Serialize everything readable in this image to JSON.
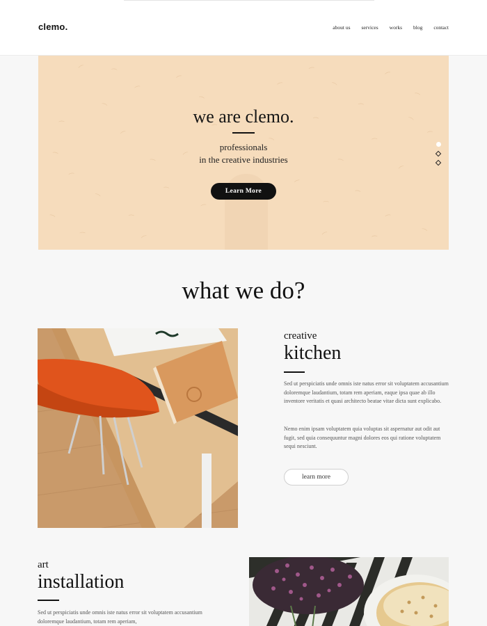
{
  "header": {
    "logo": "clemo.",
    "nav": [
      "about us",
      "services",
      "works",
      "blog",
      "contact"
    ]
  },
  "hero": {
    "title": "we are clemo.",
    "subtitle_line1": "professionals",
    "subtitle_line2": "in the creative industries",
    "button_label": "Learn More",
    "background_color": "#f6dcbc",
    "slides": 3,
    "active_slide": 1
  },
  "what_we_do": {
    "title": "what we do?",
    "kitchen": {
      "eyebrow": "creative",
      "heading": "kitchen",
      "paragraph1": "Sed ut perspiciatis unde omnis iste natus error sit voluptatem accusantium doloremque laudantium, totam rem aperiam, eaque ipsa quae ab illo inventore veritatis et quasi architecto beatae vitae dicta sunt explicabo.",
      "paragraph2": "Nemo enim ipsam voluptatem quia voluptas sit aspernatur aut odit aut fugit, sed quia consequuntur magni dolores eos qui ratione voluptatem sequi nesciunt.",
      "button_label": "learn more"
    },
    "installation": {
      "eyebrow": "art",
      "heading": "installation",
      "paragraph1": "Sed ut perspiciatis unde omnis iste natus error sit voluptatem accusantium doloremque laudantium, totam rem aperiam,"
    }
  },
  "colors": {
    "accent_dark": "#111111",
    "hero_peach": "#f6dcbc",
    "page_bg": "#f7f7f7"
  }
}
